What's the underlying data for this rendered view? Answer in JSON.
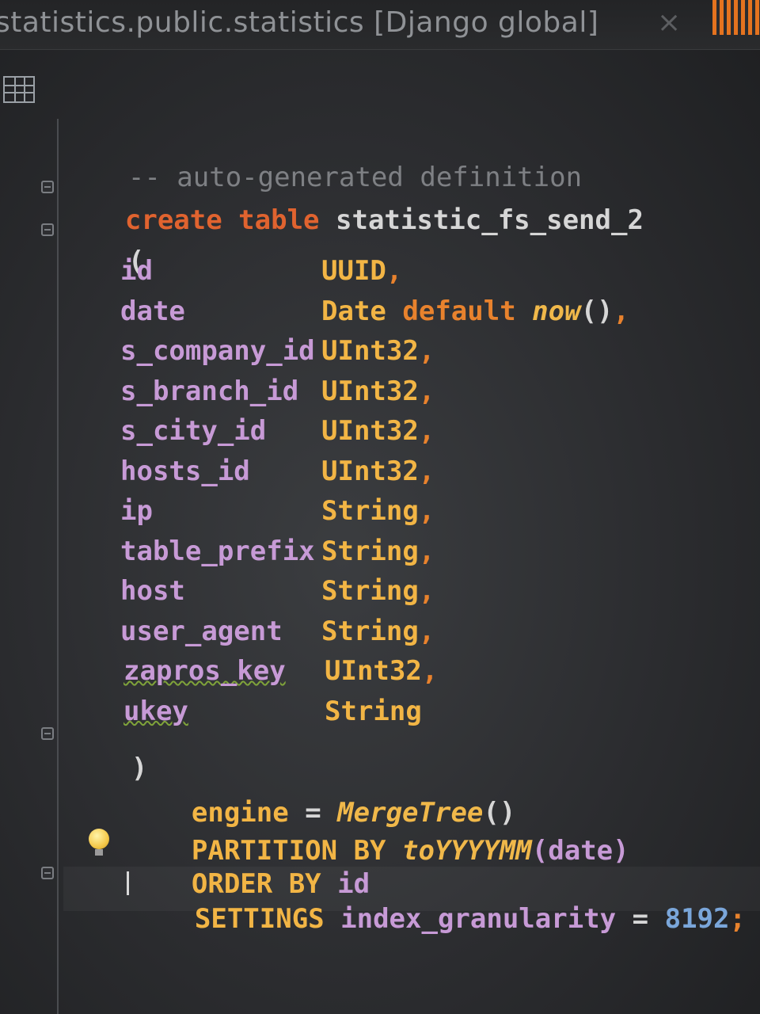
{
  "window": {
    "title": "statistics.public.statistics [Django global]",
    "close_label": "×"
  },
  "editor": {
    "comment": "-- auto-generated definition",
    "create_kw": "create table",
    "table_name": "statistic_fs_send_2",
    "open_paren": "(",
    "close_paren": ")",
    "columns": [
      {
        "name": "id",
        "type": "UUID",
        "punct": ","
      },
      {
        "name": "date",
        "type": "Date",
        "extra_kw": "default",
        "extra_fn": "now",
        "extra_tail": "()",
        "punct": ","
      },
      {
        "name": "s_company_id",
        "type": "UInt32",
        "punct": ","
      },
      {
        "name": "s_branch_id",
        "type": "UInt32",
        "punct": ","
      },
      {
        "name": "s_city_id",
        "type": "UInt32",
        "punct": ","
      },
      {
        "name": "hosts_id",
        "type": "UInt32",
        "punct": ","
      },
      {
        "name": "ip",
        "type": "String",
        "punct": ","
      },
      {
        "name": "table_prefix",
        "type": "String",
        "punct": ","
      },
      {
        "name": "host",
        "type": "String",
        "punct": ","
      },
      {
        "name": "user_agent",
        "type": "String",
        "punct": ","
      },
      {
        "name": "zapros_key",
        "type": "UInt32",
        "punct": ","
      },
      {
        "name": "ukey",
        "type": "String",
        "punct": ""
      }
    ],
    "engine_kw": "engine",
    "engine_eq": "=",
    "engine_fn": "MergeTree",
    "engine_tail": "()",
    "partition_kw": "PARTITION BY",
    "partition_fn": "toYYYYMM",
    "partition_arg": "(date)",
    "order_kw": "ORDER BY",
    "order_col": "id",
    "settings_kw": "SETTINGS",
    "settings_name": "index_granularity",
    "settings_eq": "=",
    "settings_value": "8192",
    "settings_end": ";"
  }
}
